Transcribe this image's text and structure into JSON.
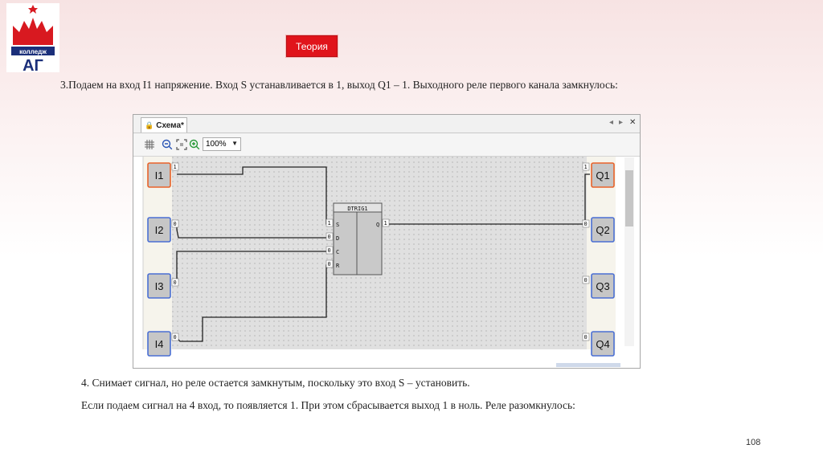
{
  "logo": {
    "text": "колледж",
    "sub": "АГ"
  },
  "theory_button": {
    "label": "Теория"
  },
  "text": {
    "p1": "3.Подаем на вход I1 напряжение. Вход S устанавливается в 1, выход Q1 – 1. Выходного реле первого канала замкнулось:",
    "p2": "4. Снимает сигнал, но реле остается замкнутым, поскольку это вход S – установить.",
    "p3": "Если подаем сигнал на 4 вход, то появляется 1. При этом сбрасывается выход 1 в ноль. Реле разомкнулось:"
  },
  "page_number": "108",
  "app": {
    "tab_label": "Схема*",
    "zoom_value": "100%",
    "inputs": [
      {
        "label": "I1",
        "value": "1",
        "active": true
      },
      {
        "label": "I2",
        "value": "0",
        "active": false
      },
      {
        "label": "I3",
        "value": "0",
        "active": false
      },
      {
        "label": "I4",
        "value": "0",
        "active": false
      }
    ],
    "outputs": [
      {
        "label": "Q1",
        "value": "1",
        "active": true
      },
      {
        "label": "Q2",
        "value": "0",
        "active": false
      },
      {
        "label": "Q3",
        "value": "0",
        "active": false
      },
      {
        "label": "Q4",
        "value": "0",
        "active": false
      }
    ],
    "block": {
      "name": "DTRIG1",
      "pins": [
        "S",
        "D",
        "C",
        "R"
      ],
      "pin_values": [
        "1",
        "0",
        "0",
        "0"
      ],
      "output_pin": "Q",
      "output_value": "1"
    }
  },
  "colors": {
    "accent": "#e0141b",
    "active_border": "#e8622a",
    "inactive_border": "#4a6fd4"
  }
}
